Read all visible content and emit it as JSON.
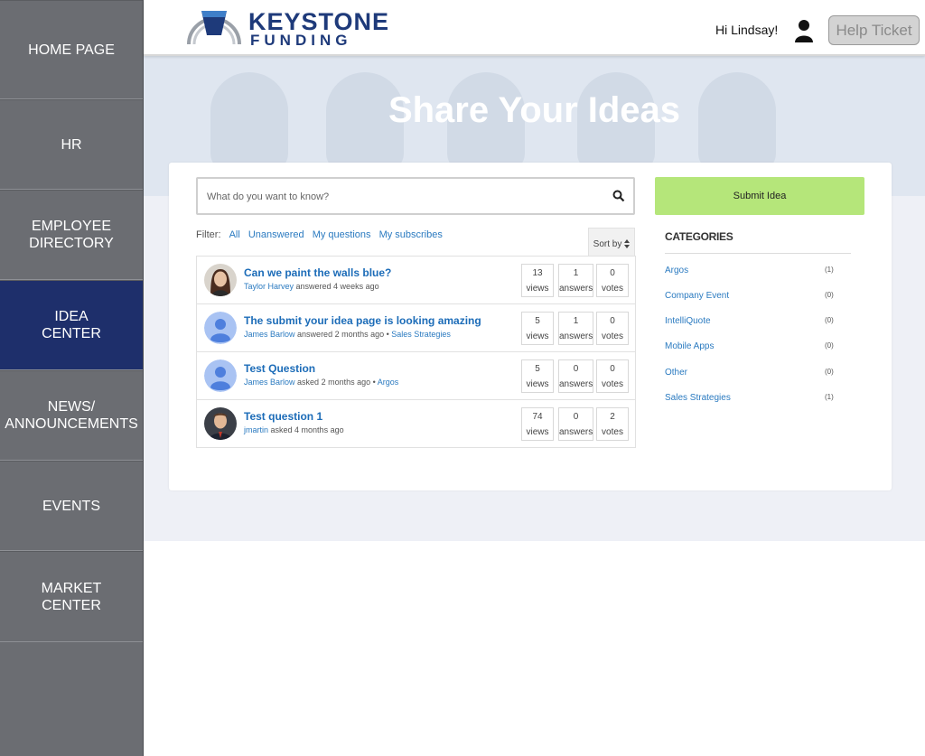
{
  "sidebar": {
    "items": [
      {
        "label": "HOME PAGE"
      },
      {
        "label": "HR"
      },
      {
        "label": "EMPLOYEE\nDIRECTORY"
      },
      {
        "label": "IDEA\nCENTER"
      },
      {
        "label": "NEWS/\nANNOUNCEMENTS"
      },
      {
        "label": "EVENTS"
      },
      {
        "label": "MARKET\nCENTER"
      }
    ],
    "active": "IDEA\nCENTER"
  },
  "header": {
    "logo_line1": "KEYSTONE",
    "logo_line2": "FUNDING",
    "greeting": "Hi Lindsay!",
    "help_label": "Help Ticket"
  },
  "hero": {
    "title": "Share Your Ideas"
  },
  "search": {
    "placeholder": "What do you want to know?"
  },
  "filter": {
    "label": "Filter:",
    "options": [
      "All",
      "Unanswered",
      "My questions",
      "My subscribes"
    ]
  },
  "sort_label": "Sort by",
  "questions": [
    {
      "title": "Can we paint the walls blue?",
      "author": "Taylor Harvey",
      "action": "answered 4 weeks ago",
      "category": "",
      "views": "13",
      "answers": "1",
      "votes": "0",
      "avatar": "photo-woman"
    },
    {
      "title": "The submit your idea page is looking amazing",
      "author": "James Barlow",
      "action": "answered 2 months ago",
      "category": "Sales Strategies",
      "views": "5",
      "answers": "1",
      "votes": "0",
      "avatar": "default-user-icon"
    },
    {
      "title": "Test Question",
      "author": "James Barlow",
      "action": "asked 2 months ago",
      "category": "Argos",
      "views": "5",
      "answers": "0",
      "votes": "0",
      "avatar": "default-user-icon"
    },
    {
      "title": "Test question 1",
      "author": "jmartin",
      "action": "asked 4 months ago",
      "category": "",
      "views": "74",
      "answers": "0",
      "votes": "2",
      "avatar": "photo-man"
    }
  ],
  "stat_labels": {
    "views": "views",
    "answers": "answers",
    "votes": "votes"
  },
  "submit_label": "Submit Idea",
  "categories_title": "CATEGORIES",
  "categories": [
    {
      "name": "Argos",
      "count": "(1)"
    },
    {
      "name": "Company Event",
      "count": "(0)"
    },
    {
      "name": "IntelliQuote",
      "count": "(0)"
    },
    {
      "name": "Mobile Apps",
      "count": "(0)"
    },
    {
      "name": "Other",
      "count": "(0)"
    },
    {
      "name": "Sales Strategies",
      "count": "(1)"
    }
  ],
  "colors": {
    "sidebar": "#6b6d72",
    "active_nav": "#1e2f6b",
    "submit": "#b5e67a",
    "link": "#2a7ac0"
  }
}
